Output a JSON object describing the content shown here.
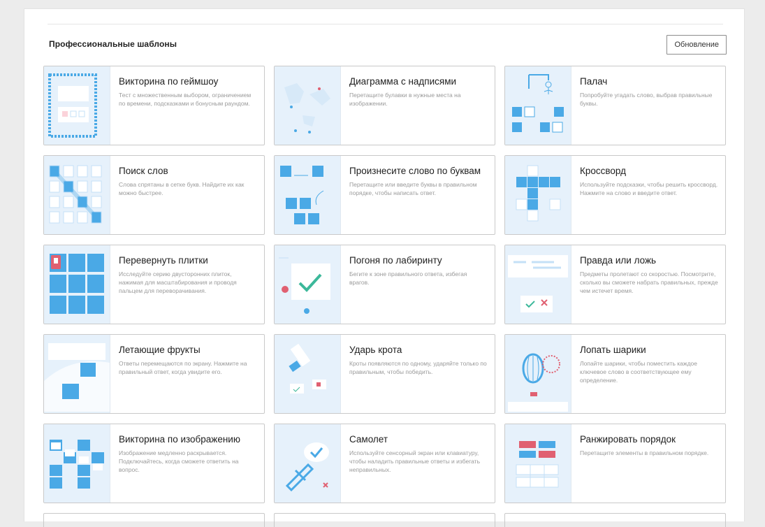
{
  "header": {
    "title": "Профессиональные шаблоны",
    "update_label": "Обновление"
  },
  "colors": {
    "accent": "#4aa9e6",
    "thumb_bg": "#e6f1fb",
    "check": "#3cb89a",
    "wrong": "#e06071"
  },
  "cards": [
    {
      "title": "Викторина по геймшоу",
      "desc": "Тест с множественным выбором, ограничением по времени, подсказками и бонусным раундом.",
      "icon": "gameshow-quiz-icon"
    },
    {
      "title": "Диаграмма с надписями",
      "desc": "Перетащите булавки в нужные места на изображении.",
      "icon": "labelled-diagram-icon"
    },
    {
      "title": "Палач",
      "desc": "Попробуйте угадать слово, выбрав правильные буквы.",
      "icon": "hangman-icon"
    },
    {
      "title": "Поиск слов",
      "desc": "Слова спрятаны в сетке букв. Найдите их как можно быстрее.",
      "icon": "wordsearch-icon"
    },
    {
      "title": "Произнесите слово по буквам",
      "desc": "Перетащите или введите буквы в правильном порядке, чтобы написать ответ.",
      "icon": "spell-word-icon"
    },
    {
      "title": "Кроссворд",
      "desc": "Используйте подсказки, чтобы решить кроссворд. Нажмите на слово и введите ответ.",
      "icon": "crossword-icon"
    },
    {
      "title": "Перевернуть плитки",
      "desc": "Исследуйте серию двусторонних плиток, нажимая для масштабирования и проводя пальцем для переворачивания.",
      "icon": "flip-tiles-icon"
    },
    {
      "title": "Погоня по лабиринту",
      "desc": "Бегите к зоне правильного ответа, избегая врагов.",
      "icon": "maze-chase-icon"
    },
    {
      "title": "Правда или ложь",
      "desc": "Предметы пролетают со скоростью. Посмотрите, сколько вы сможете набрать правильных, прежде чем истечет время.",
      "icon": "true-false-icon"
    },
    {
      "title": "Летающие фрукты",
      "desc": "Ответы перемещаются по экрану. Нажмите на правильный ответ, когда увидите его.",
      "icon": "flying-fruit-icon"
    },
    {
      "title": "Ударь крота",
      "desc": "Кроты появляются по одному, ударяйте только по правильным, чтобы победить.",
      "icon": "whack-mole-icon"
    },
    {
      "title": "Лопать шарики",
      "desc": "Лопайте шарики, чтобы поместить каждое ключевое слово в соответствующее ему определение.",
      "icon": "balloon-pop-icon"
    },
    {
      "title": "Викторина по изображению",
      "desc": "Изображение медленно раскрывается. Подключайтесь, когда сможете ответить на вопрос.",
      "icon": "image-quiz-icon"
    },
    {
      "title": "Самолет",
      "desc": "Используйте сенсорный экран или клавиатуру, чтобы наладить правильные ответы и избегать неправильных.",
      "icon": "airplane-icon"
    },
    {
      "title": "Ранжировать порядок",
      "desc": "Перетащите элементы в правильном порядке.",
      "icon": "rank-order-icon"
    }
  ]
}
